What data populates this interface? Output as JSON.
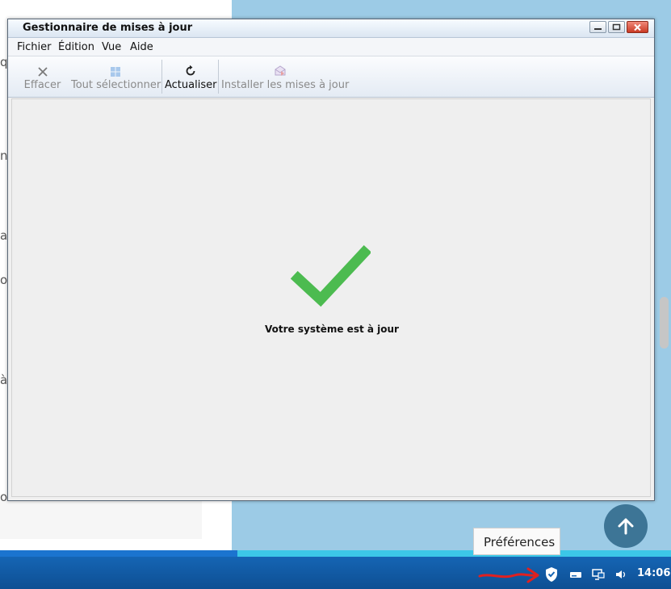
{
  "background": {
    "fragments": [
      "q",
      "n",
      "a",
      "o",
      "à",
      "ol"
    ]
  },
  "window": {
    "title": "Gestionnaire de mises à jour",
    "menu": [
      "Fichier",
      "Édition",
      "Vue",
      "Aide"
    ],
    "toolbar": {
      "clear": "Effacer",
      "select_all": "Tout sélectionner",
      "refresh": "Actualiser",
      "install": "Installer les mises à jour"
    },
    "status": "Votre système est à jour"
  },
  "page_progress": 0.354,
  "tooltip": "Préférences",
  "taskbar": {
    "clock": "14:06"
  },
  "colors": {
    "check": "#4cbb50",
    "taskbar": "#1565b4",
    "accent_arrow": "#e02020"
  }
}
